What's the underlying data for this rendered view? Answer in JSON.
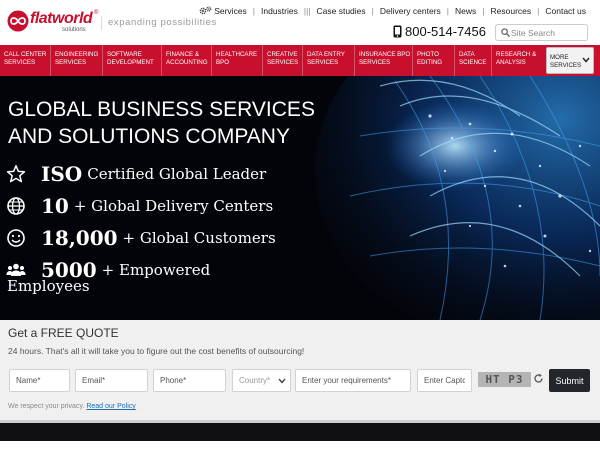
{
  "brand": {
    "logo_word": "flatworld",
    "logo_sub": "solutions",
    "logo_reg": "®",
    "tagline": "expanding possibilities"
  },
  "topnav": {
    "services": "Services",
    "industries": "Industries",
    "case_studies": "Case studies",
    "delivery_centers": "Delivery centers",
    "news": "News",
    "resources": "Resources",
    "contact": "Contact us",
    "separator": "|",
    "separator_triple": "|||"
  },
  "phone": "800-514-7456",
  "search": {
    "placeholder": "Site Search"
  },
  "mainnav": {
    "items": [
      {
        "line1": "Call Center",
        "line2": "Services"
      },
      {
        "line1": "Engineering",
        "line2": "Services"
      },
      {
        "line1": "Software",
        "line2": "Development"
      },
      {
        "line1": "Finance &",
        "line2": "Accounting"
      },
      {
        "line1": "Healthcare",
        "line2": "BPO"
      },
      {
        "line1": "Creative",
        "line2": "Services"
      },
      {
        "line1": "Data Entry",
        "line2": "Services"
      },
      {
        "line1": "Insurance BPO",
        "line2": "Services"
      },
      {
        "line1": "Photo",
        "line2": "Editing"
      },
      {
        "line1": "Data",
        "line2": "Science"
      },
      {
        "line1": "Research &",
        "line2": "Analysis"
      }
    ],
    "more": {
      "line1": "More",
      "line2": "Services"
    }
  },
  "hero": {
    "title_line1": "GLOBAL BUSINESS SERVICES",
    "title_line2": "AND SOLUTIONS COMPANY",
    "stats": [
      {
        "icon": "star-icon",
        "number": "ISO",
        "text": "Certified Global Leader"
      },
      {
        "icon": "globe-icon",
        "number": "10",
        "text": "+ Global Delivery Centers"
      },
      {
        "icon": "smile-icon",
        "number": "18,000",
        "text": "+ Global Customers"
      },
      {
        "icon": "users-icon",
        "number": "5000",
        "text": "+ Empowered",
        "text_line2": "Employees"
      }
    ]
  },
  "quote": {
    "title": "Get a FREE QUOTE",
    "subtitle": "24 hours. That's all it will take you to figure out the cost benefits of outsourcing!",
    "name_placeholder": "Name*",
    "email_placeholder": "Email*",
    "phone_placeholder": "Phone*",
    "country_placeholder": "Country*",
    "requirements_placeholder": "Enter your requirements*",
    "captcha_placeholder": "Enter Captcha",
    "captcha_text": "HT P3",
    "submit": "Submit",
    "privacy_text": "We respect your privacy.",
    "privacy_link": "Read our Policy"
  },
  "colors": {
    "brand_red": "#c8102e",
    "hero_bg": "#030409",
    "submit_bg": "#23272b",
    "link_blue": "#1a6fb3"
  }
}
